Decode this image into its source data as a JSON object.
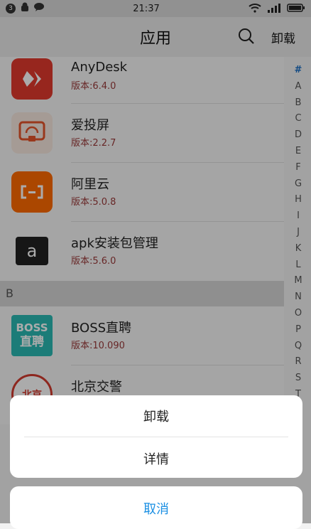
{
  "status_bar": {
    "notification_count": "3",
    "time": "21:37"
  },
  "header": {
    "title": "应用",
    "action_label": "卸载",
    "search_icon": "search-icon"
  },
  "apps": [
    {
      "name": "AnyDesk",
      "version": "版本:6.4.0",
      "icon": "anydesk-icon",
      "icon_color": "#e23a2e"
    },
    {
      "name": "爱投屏",
      "version": "版本:2.2.7",
      "icon": "screen-cast-icon",
      "icon_color": "#f7e8df"
    },
    {
      "name": "阿里云",
      "version": "版本:5.0.8",
      "icon": "aliyun-icon",
      "icon_color": "#ff6a00"
    },
    {
      "name": "apk安装包管理",
      "version": "版本:5.6.0",
      "icon": "apk-manager-icon",
      "icon_color": "#222222"
    }
  ],
  "section_b": {
    "label": "B"
  },
  "apps_b": [
    {
      "name": "BOSS直聘",
      "version": "版本:10.090",
      "icon": "boss-icon",
      "icon_color": "#2ab9b3",
      "icon_text_1": "BOSS",
      "icon_text_2": "直聘"
    },
    {
      "name": "北京交警",
      "version": "",
      "icon": "beijing-police-icon",
      "icon_color": "#d33b2f",
      "icon_text_1": "北京"
    }
  ],
  "index_letters": [
    "#",
    "A",
    "B",
    "C",
    "D",
    "E",
    "F",
    "G",
    "H",
    "I",
    "J",
    "K",
    "L",
    "M",
    "N",
    "O",
    "P",
    "Q",
    "R",
    "S",
    "T"
  ],
  "action_sheet": {
    "uninstall": "卸载",
    "details": "详情",
    "cancel": "取消",
    "cancel_color": "#1a8fe3"
  }
}
